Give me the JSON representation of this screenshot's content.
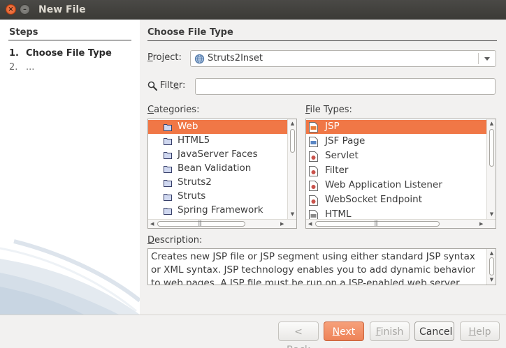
{
  "window": {
    "title": "New File"
  },
  "steps": {
    "title": "Steps",
    "items": [
      {
        "num": "1.",
        "label": "Choose File Type"
      },
      {
        "num": "2.",
        "label": "..."
      }
    ]
  },
  "main": {
    "title": "Choose File Type",
    "project_label_pre": "",
    "project_label_ul": "P",
    "project_label_post": "roject:",
    "project_value": "Struts2Inset",
    "filter_label_pre": "Filt",
    "filter_label_ul": "e",
    "filter_label_post": "r:",
    "filter_value": "",
    "categories_label_pre": "",
    "categories_label_ul": "C",
    "categories_label_post": "ategories:",
    "file_types_label_pre": "",
    "file_types_label_ul": "F",
    "file_types_label_post": "ile Types:",
    "description_label_pre": "",
    "description_label_ul": "D",
    "description_label_post": "escription:"
  },
  "categories": [
    "Web",
    "HTML5",
    "JavaServer Faces",
    "Bean Validation",
    "Struts2",
    "Struts",
    "Spring Framework"
  ],
  "file_types": [
    "JSP",
    "JSF Page",
    "Servlet",
    "Filter",
    "Web Application Listener",
    "WebSocket Endpoint",
    "HTML"
  ],
  "description": "Creates new JSP file or JSP segment using either standard JSP syntax or XML syntax. JSP technology enables you to add dynamic behavior to web pages. A JSP file must be run on a JSP-enabled web server.",
  "buttons": {
    "back_pre": "< ",
    "back_ul": "B",
    "back_post": "ack",
    "next_pre": "",
    "next_ul": "N",
    "next_post": "ext >",
    "finish_pre": "",
    "finish_ul": "F",
    "finish_post": "inish",
    "cancel": "Cancel",
    "help_pre": "",
    "help_ul": "H",
    "help_post": "elp"
  },
  "colors": {
    "accent": "#f07746",
    "titlebar": "#3c3b37"
  },
  "icons": {
    "project": "globe-icon",
    "filter": "magnifier-icon",
    "category": "folder-icon",
    "file_type": "file-icon"
  }
}
